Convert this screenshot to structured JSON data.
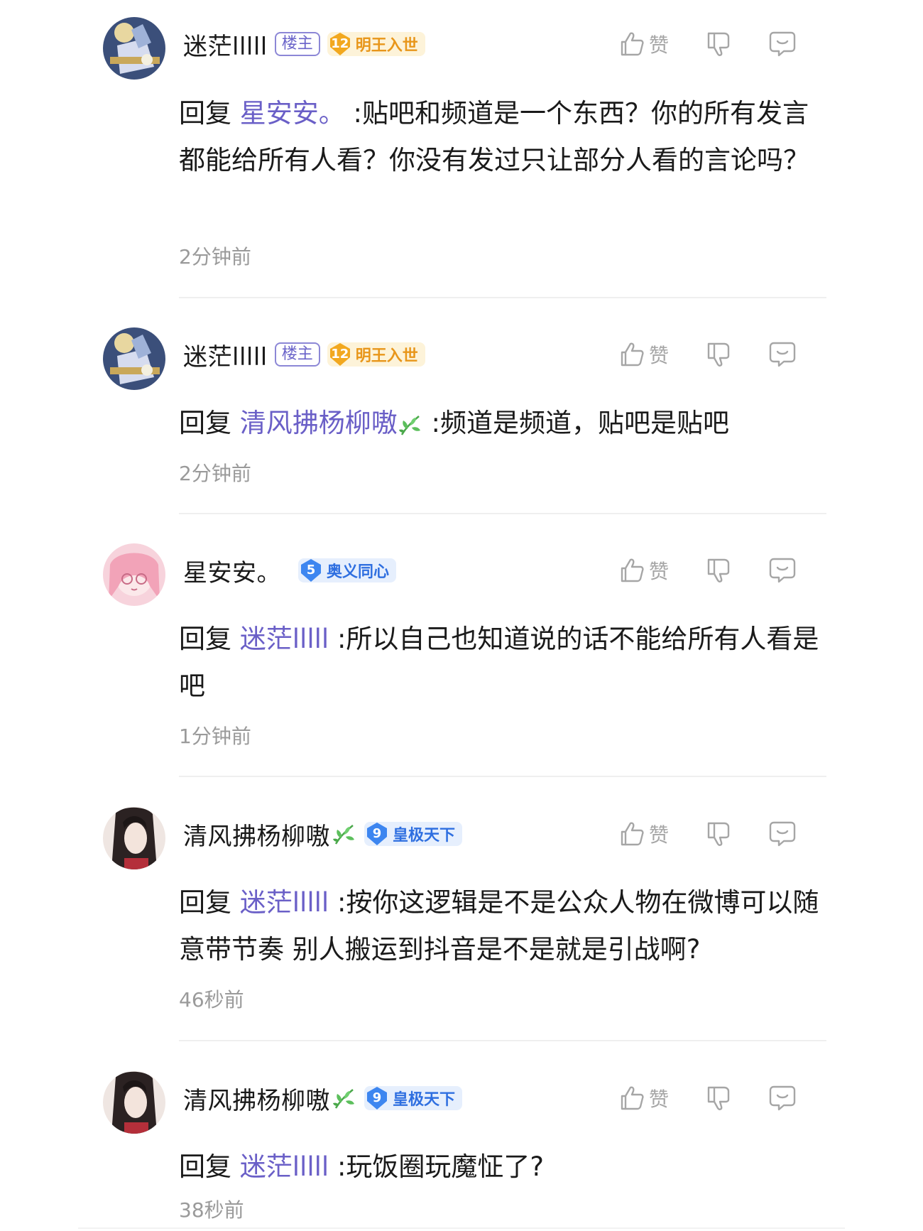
{
  "comments": [
    {
      "username": "迷茫lllll",
      "owner_badge": "楼主",
      "level": "12",
      "level_title": "明王入世",
      "badge_color": "gold",
      "avatar": "anime-avatar-blue",
      "like_label": "赞",
      "reply_prefix": "回复",
      "reply_to": "星安安。",
      "text": ":贴吧和频道是一个东西？你的所有发言都能给所有人看？你没有发过只让部分人看的言论吗？",
      "time": "2分钟前"
    },
    {
      "username": "迷茫lllll",
      "owner_badge": "楼主",
      "level": "12",
      "level_title": "明王入世",
      "badge_color": "gold",
      "avatar": "anime-avatar-blue",
      "like_label": "赞",
      "reply_prefix": "回复",
      "reply_to": "清风拂杨柳嗷",
      "reply_to_icon": "leaf-icon",
      "text": ":频道是频道，贴吧是贴吧",
      "time": "2分钟前"
    },
    {
      "username": "星安安。",
      "level": "5",
      "level_title": "奥义同心",
      "badge_color": "blue",
      "avatar": "anime-avatar-pink",
      "like_label": "赞",
      "reply_prefix": "回复",
      "reply_to": "迷茫lllll",
      "text": ":所以自己也知道说的话不能给所有人看是吧",
      "time": "1分钟前"
    },
    {
      "username": "清风拂杨柳嗷",
      "username_icon": "leaf-icon",
      "level": "9",
      "level_title": "皇极天下",
      "badge_color": "blue",
      "avatar": "dark-hair-avatar",
      "like_label": "赞",
      "reply_prefix": "回复",
      "reply_to": "迷茫lllll",
      "text": ":按你这逻辑是不是公众人物在微博可以随意带节奏 别人搬运到抖音是不是就是引战啊?",
      "time": "46秒前"
    },
    {
      "username": "清风拂杨柳嗷",
      "username_icon": "leaf-icon",
      "level": "9",
      "level_title": "皇极天下",
      "badge_color": "blue",
      "avatar": "dark-hair-avatar",
      "like_label": "赞",
      "reply_prefix": "回复",
      "reply_to": "迷茫lllll",
      "text": ":玩饭圈玩魔怔了?",
      "time": "38秒前"
    }
  ],
  "colors": {
    "reply_target": "#6a5fc7",
    "gold_badge": "#e8961a",
    "blue_badge": "#2f6fe0",
    "muted": "#9a9a9a"
  }
}
